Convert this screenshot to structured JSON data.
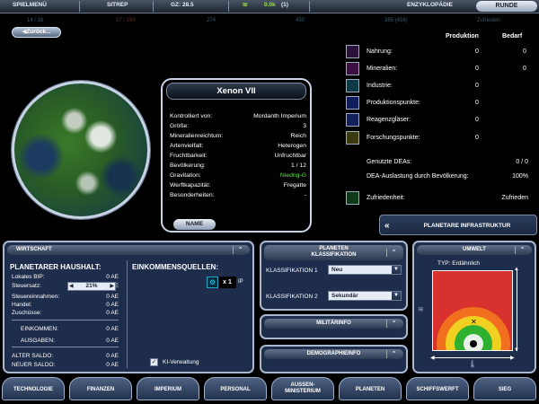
{
  "topbar": {
    "spielmenu": "SPIELMENÜ",
    "sitrep": "SITREP",
    "gz": "GZ: 28.5",
    "resource_value": "0.0k",
    "resource_delta": "(1)",
    "enzyklopadie": "ENZYKLOPÄDIE",
    "runde": "RUNDE"
  },
  "stats": {
    "s1": "14 / 16",
    "s2": "67 / 195",
    "s3": "274",
    "s4": "450",
    "s5": "385 (456)",
    "s6": "Zufrieden"
  },
  "back_label": "◀Zurück...",
  "planet": {
    "name": "Xenon VII",
    "rows": [
      {
        "label": "Kontrolliert von:",
        "value": "Mordanth Imperium"
      },
      {
        "label": "Größe:",
        "value": "3"
      },
      {
        "label": "Mineralienreichtum:",
        "value": "Reich"
      },
      {
        "label": "Artenvielfalt:",
        "value": "Heterogen"
      },
      {
        "label": "Fruchtbarkeit:",
        "value": "Unfruchtbar"
      },
      {
        "label": "Bevölkerung:",
        "value": "1 / 12"
      },
      {
        "label": "Gravitation:",
        "value": "Niedrig-G"
      },
      {
        "label": "Werftkapazität:",
        "value": "Fregatte"
      },
      {
        "label": "Besonderheiten:",
        "value": "-"
      }
    ],
    "name_button": "NAME"
  },
  "production": {
    "head_prod": "Produktion",
    "head_bedarf": "Bedarf",
    "rows": [
      {
        "label": "Nahrung:",
        "prod": "0",
        "bedarf": "0",
        "icon": "food-icon",
        "color": "#b04acb"
      },
      {
        "label": "Mineralien:",
        "prod": "0",
        "bedarf": "0",
        "icon": "minerals-icon",
        "color": "#c040c0"
      },
      {
        "label": "Industrie:",
        "prod": "0",
        "bedarf": "",
        "icon": "industry-icon",
        "color": "#1aa7c8"
      },
      {
        "label": "Produktionspunkte:",
        "prod": "0",
        "bedarf": "",
        "icon": "production-icon",
        "color": "#2b4ad8"
      },
      {
        "label": "Reagenzgläser:",
        "prod": "0",
        "bedarf": "",
        "icon": "test-tube-icon",
        "color": "#3a5ad0"
      },
      {
        "label": "Forschungspunkte:",
        "prod": "0",
        "bedarf": "",
        "icon": "research-icon",
        "color": "#c8c040"
      }
    ],
    "dea_label": "Genutzte DEAs:",
    "dea_value": "0 / 0",
    "auslastung_label": "DEA-Auslastung durch Bevölkerung:",
    "auslastung_value": "100%",
    "zufriedenheit_label": "Zufriedenheit:",
    "zufriedenheit_value": "Zufrieden",
    "infra_button": "PLANETARE INFRASTRUKTUR"
  },
  "wirtschaft": {
    "title": "WIRTSCHAFT",
    "haushalt_title": "PLANETARER HAUSHALT:",
    "einkommen_title": "EINKOMMENSQUELLEN:",
    "rows": [
      {
        "label": "Lokales BIP:",
        "value": "0 AE"
      },
      {
        "label": "Steuersatz:",
        "value": "0 AE"
      },
      {
        "label": "Steuereinnahmen:",
        "value": "0 AE"
      },
      {
        "label": "Handel:",
        "value": "0 AE"
      },
      {
        "label": "Zuschüsse:",
        "value": "0 AE"
      }
    ],
    "tax_rate": "21%",
    "einkommen_label": "EINKOMMEN:",
    "einkommen_value": "0 AE",
    "ausgaben_label": "AUSGABEN:",
    "ausgaben_value": "0 AE",
    "alter_saldo_label": "ALTER SALDO:",
    "alter_saldo_value": "0 AE",
    "neuer_saldo_label": "NEUER SALDO:",
    "neuer_saldo_value": "0 AE",
    "source_count": "x 1",
    "source_unit": "IP",
    "ki_label": "KI-Verwaltung"
  },
  "klassifikation": {
    "title_line1": "PLANETEN",
    "title_line2": "KLASSIFIKATION",
    "k1_label": "KLASSIFIKATION 1",
    "k1_value": "Neu",
    "k2_label": "KLASSIFIKATION 2",
    "k2_value": "Sekundär",
    "militar": "MILITÄRINFO",
    "demografie": "DEMOGRAPHIEINFO"
  },
  "umwelt": {
    "title": "UMWELT",
    "typ_label": "TYP:",
    "typ_value": "Erdähnlich"
  },
  "nav": [
    {
      "label": "TECHNOLOGIE"
    },
    {
      "label": "FINANZEN"
    },
    {
      "label": "IMPERIUM"
    },
    {
      "label": "PERSONAL"
    },
    {
      "label": "AUSSEN-\nMINISTERIUM"
    },
    {
      "label": "PLANETEN"
    },
    {
      "label": "SCHIFFSWERFT"
    },
    {
      "label": "SIEG"
    }
  ]
}
